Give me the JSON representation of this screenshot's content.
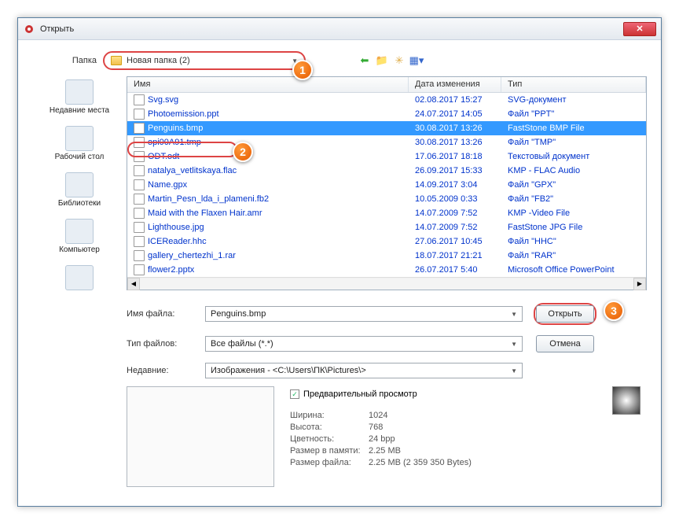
{
  "window": {
    "title": "Открыть"
  },
  "folder": {
    "label": "Папка",
    "name": "Новая папка (2)"
  },
  "columns": {
    "name": "Имя",
    "date": "Дата изменения",
    "type": "Тип"
  },
  "files": [
    {
      "name": "Svg.svg",
      "date": "02.08.2017 15:27",
      "type": "SVG-документ"
    },
    {
      "name": "Photoemission.ppt",
      "date": "24.07.2017 14:05",
      "type": "Файл \"PPT\""
    },
    {
      "name": "Penguins.bmp",
      "date": "30.08.2017 13:26",
      "type": "FastStone BMP File",
      "selected": true
    },
    {
      "name": "opi00A91.tmp",
      "date": "30.08.2017 13:26",
      "type": "Файл \"TMP\""
    },
    {
      "name": "ODT.odt",
      "date": "17.06.2017 18:18",
      "type": "Текстовый документ"
    },
    {
      "name": "natalya_vetlitskaya.flac",
      "date": "26.09.2017 15:33",
      "type": "KMP - FLAC Audio"
    },
    {
      "name": "Name.gpx",
      "date": "14.09.2017 3:04",
      "type": "Файл \"GPX\""
    },
    {
      "name": "Martin_Pesn_lda_i_plameni.fb2",
      "date": "10.05.2009 0:33",
      "type": "Файл \"FB2\""
    },
    {
      "name": "Maid with the Flaxen Hair.amr",
      "date": "14.07.2009 7:52",
      "type": "KMP -Video File"
    },
    {
      "name": "Lighthouse.jpg",
      "date": "14.07.2009 7:52",
      "type": "FastStone JPG File"
    },
    {
      "name": "ICEReader.hhc",
      "date": "27.06.2017 10:45",
      "type": "Файл \"HHC\""
    },
    {
      "name": "gallery_chertezhi_1.rar",
      "date": "18.07.2017 21:21",
      "type": "Файл \"RAR\""
    },
    {
      "name": "flower2.pptx",
      "date": "26.07.2017 5:40",
      "type": "Microsoft Office PowerPoint"
    }
  ],
  "places": [
    {
      "label": "Недавние места"
    },
    {
      "label": "Рабочий стол"
    },
    {
      "label": "Библиотеки"
    },
    {
      "label": "Компьютер"
    },
    {
      "label": ""
    }
  ],
  "form": {
    "filename_label": "Имя файла:",
    "filename_value": "Penguins.bmp",
    "filetype_label": "Тип файлов:",
    "filetype_value": "Все файлы (*.*)",
    "recent_label": "Недавние:",
    "recent_value": "Изображения  -  <C:\\Users\\ПК\\Pictures\\>",
    "open": "Открыть",
    "cancel": "Отмена"
  },
  "preview": {
    "checkbox": "Предварительный просмотр",
    "width_k": "Ширина:",
    "width_v": "1024",
    "height_k": "Высота:",
    "height_v": "768",
    "depth_k": "Цветность:",
    "depth_v": "24 bpp",
    "mem_k": "Размер в памяти:",
    "mem_v": "2.25 MB",
    "size_k": "Размер файла:",
    "size_v": "2.25 MB (2 359 350 Bytes)"
  },
  "callouts": {
    "one": "1",
    "two": "2",
    "three": "3"
  }
}
